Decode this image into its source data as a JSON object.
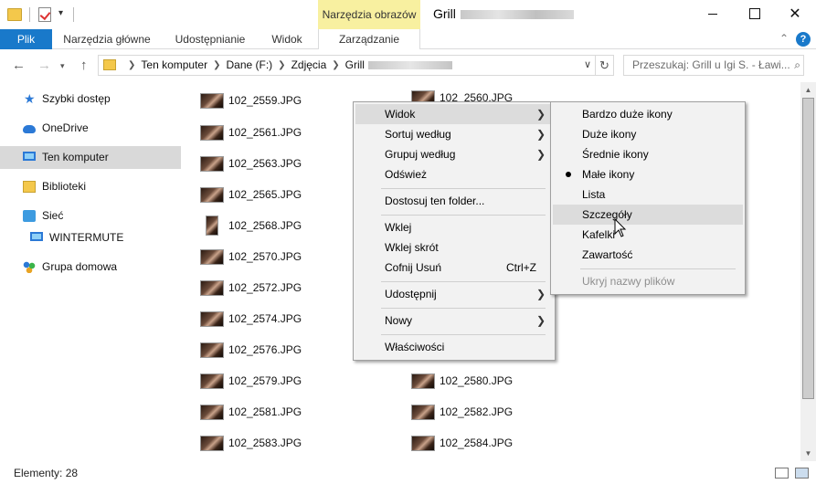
{
  "window": {
    "title": "Grill",
    "context_tab": "Narzędzia obrazów",
    "minimize": "minimize",
    "maximize": "maximize",
    "close": "✕"
  },
  "ribbon": {
    "tabs": [
      "Plik",
      "Narzędzia główne",
      "Udostępnianie",
      "Widok",
      "Zarządzanie"
    ],
    "help": "?"
  },
  "address": {
    "crumbs": [
      "Ten komputer",
      "Dane (F:)",
      "Zdjęcia",
      "Grill"
    ],
    "search_placeholder": "Przeszukaj: Grill u Igi S. - Ławi..."
  },
  "sidebar": {
    "items": [
      "Szybki dostęp",
      "OneDrive",
      "Ten komputer",
      "Biblioteki",
      "Sieć",
      "WINTERMUTE",
      "Grupa domowa"
    ]
  },
  "files": {
    "left": [
      "102_2559.JPG",
      "102_2561.JPG",
      "102_2563.JPG",
      "102_2565.JPG",
      "102_2568.JPG",
      "102_2570.JPG",
      "102_2572.JPG",
      "102_2574.JPG",
      "102_2576.JPG",
      "102_2579.JPG",
      "102_2581.JPG",
      "102_2583.JPG"
    ],
    "right": [
      "102_2580.JPG",
      "102_2582.JPG",
      "102_2584.JPG"
    ],
    "partial_top_right": "102_2560.JPG"
  },
  "context_menu": {
    "view": "Widok",
    "sort": "Sortuj według",
    "group": "Grupuj według",
    "refresh": "Odśwież",
    "customize": "Dostosuj ten folder...",
    "paste": "Wklej",
    "paste_shortcut": "Wklej skrót",
    "undo": "Cofnij Usuń",
    "undo_key": "Ctrl+Z",
    "share": "Udostępnij",
    "new": "Nowy",
    "properties": "Właściwości"
  },
  "view_menu": {
    "items": [
      "Bardzo duże ikony",
      "Duże ikony",
      "Średnie ikony",
      "Małe ikony",
      "Lista",
      "Szczegóły",
      "Kafelki",
      "Zawartość"
    ],
    "hide_names": "Ukryj nazwy plików",
    "selected": "Małe ikony",
    "hovered": "Szczegóły"
  },
  "status": {
    "count": "Elementy: 28"
  }
}
